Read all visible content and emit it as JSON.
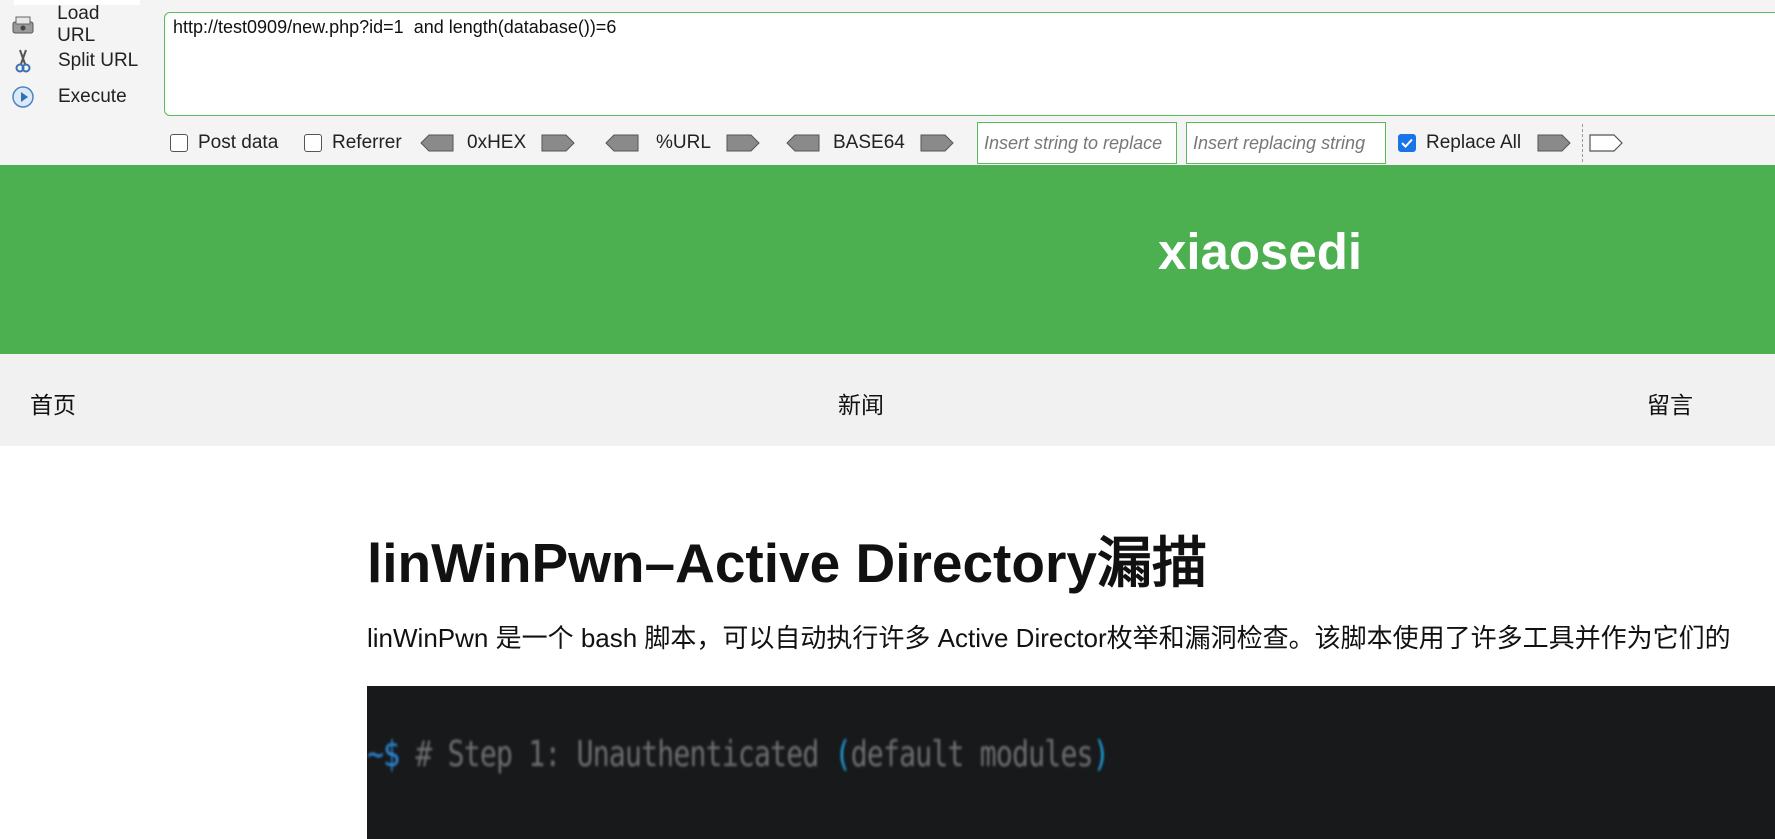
{
  "hackbar": {
    "buttons": [
      {
        "label": "Load URL",
        "icon": "load-url-icon"
      },
      {
        "label": "Split URL",
        "icon": "scissors-icon"
      },
      {
        "label": "Execute",
        "icon": "play-icon"
      }
    ],
    "url_value": "http://test0909/new.php?id=1  and length(database())=6",
    "post_data_label": "Post data",
    "post_data_checked": false,
    "referrer_label": "Referrer",
    "referrer_checked": false,
    "encoders": [
      "0xHEX",
      "%URL",
      "BASE64"
    ],
    "replace_find_placeholder": "Insert string to replace",
    "replace_with_placeholder": "Insert replacing string",
    "replace_all_label": "Replace All",
    "replace_all_checked": true,
    "accent_color": "#5cb85c"
  },
  "site": {
    "title": "xiaosedi",
    "header_color": "#4caf50",
    "nav": [
      "首页",
      "新闻",
      "留言"
    ]
  },
  "article": {
    "title": "linWinPwn–Active Directory漏描",
    "intro": "linWinPwn 是一个 bash 脚本，可以自动执行许多 Active Director枚举和漏洞检查。该脚本使用了许多工具并作为它们的",
    "code_prompt": "~$",
    "code_text": "# Step 1: Unauthenticated ",
    "code_paren_open": "(",
    "code_paren_inner": "default modules",
    "code_paren_close": ")"
  }
}
